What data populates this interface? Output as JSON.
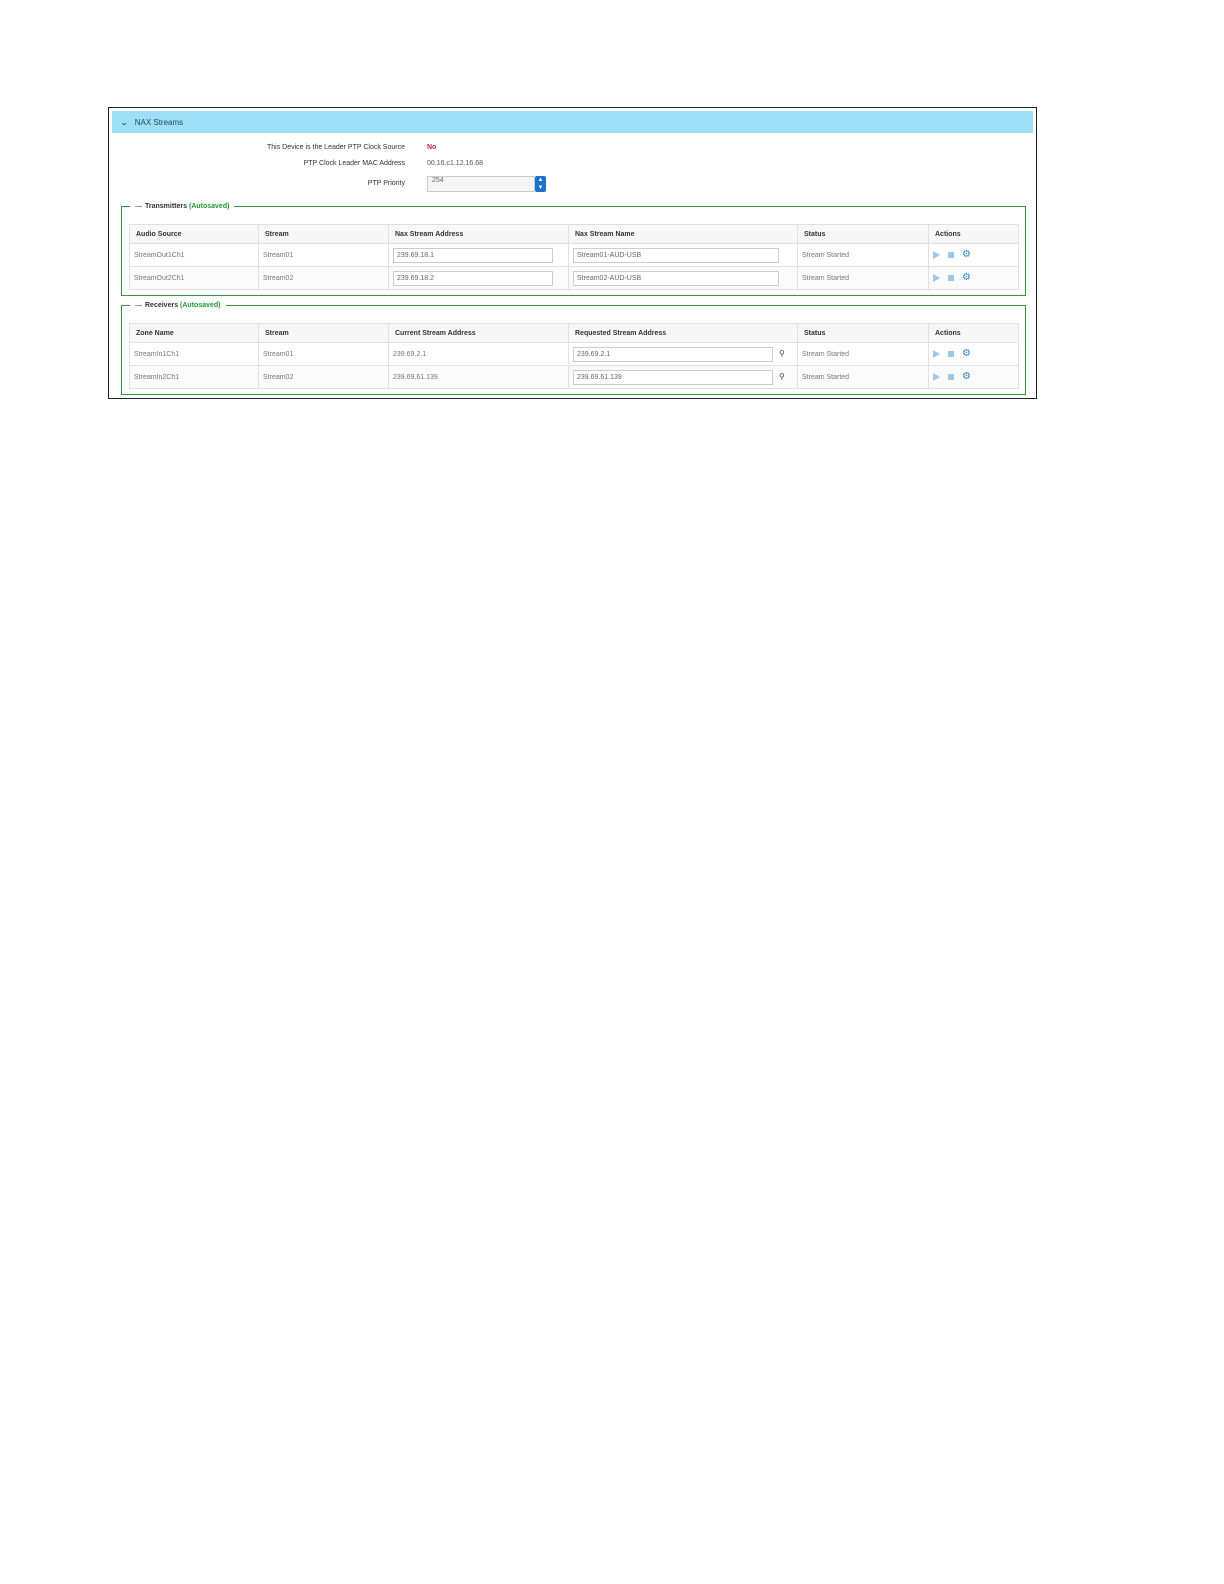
{
  "panel": {
    "title": "NAX Streams"
  },
  "properties": {
    "leader": {
      "label": "This Device is the Leader PTP Clock Source",
      "value": "No"
    },
    "mac": {
      "label": "PTP Clock Leader MAC Address",
      "value": "00.16.c1.12.16.68"
    },
    "priority": {
      "label": "PTP Priority",
      "value": "254"
    }
  },
  "transmitters": {
    "title": "Transmitters",
    "autosaved": "(Autosaved)",
    "columns": [
      "Audio Source",
      "Stream",
      "Nax Stream Address",
      "Nax Stream Name",
      "Status",
      "Actions"
    ],
    "rows": [
      {
        "audio_source": "StreamOut1Ch1",
        "stream": "Stream01",
        "address": "239.69.18.1",
        "name": "Stream01-AUD-USB",
        "status": "Stream Started"
      },
      {
        "audio_source": "StreamOut2Ch1",
        "stream": "Stream02",
        "address": "239.69.18.2",
        "name": "Stream02-AUD-USB",
        "status": "Stream Started"
      }
    ]
  },
  "receivers": {
    "title": "Receivers",
    "autosaved": "(Autosaved)",
    "columns": [
      "Zone Name",
      "Stream",
      "Current Stream Address",
      "Requested Stream Address",
      "Status",
      "Actions"
    ],
    "rows": [
      {
        "zone": "StreamIn1Ch1",
        "stream": "Stream01",
        "current": "239.69.2.1",
        "requested": "239.69.2.1",
        "status": "Stream Started"
      },
      {
        "zone": "StreamIn2Ch1",
        "stream": "Stream02",
        "current": "239.69.61.139",
        "requested": "239.69.61.139",
        "status": "Stream Started"
      }
    ]
  },
  "icons": {
    "collapse": "chevron-down-icon",
    "search": "search-icon",
    "play": "play-icon",
    "stop": "stop-icon",
    "settings": "gear-icon"
  },
  "colors": {
    "header_bg": "#9ddff5",
    "group_border": "#2e9a3a",
    "autosaved": "#1f9c2f",
    "no_value": "#d02035",
    "spinner": "#1a73d1"
  }
}
